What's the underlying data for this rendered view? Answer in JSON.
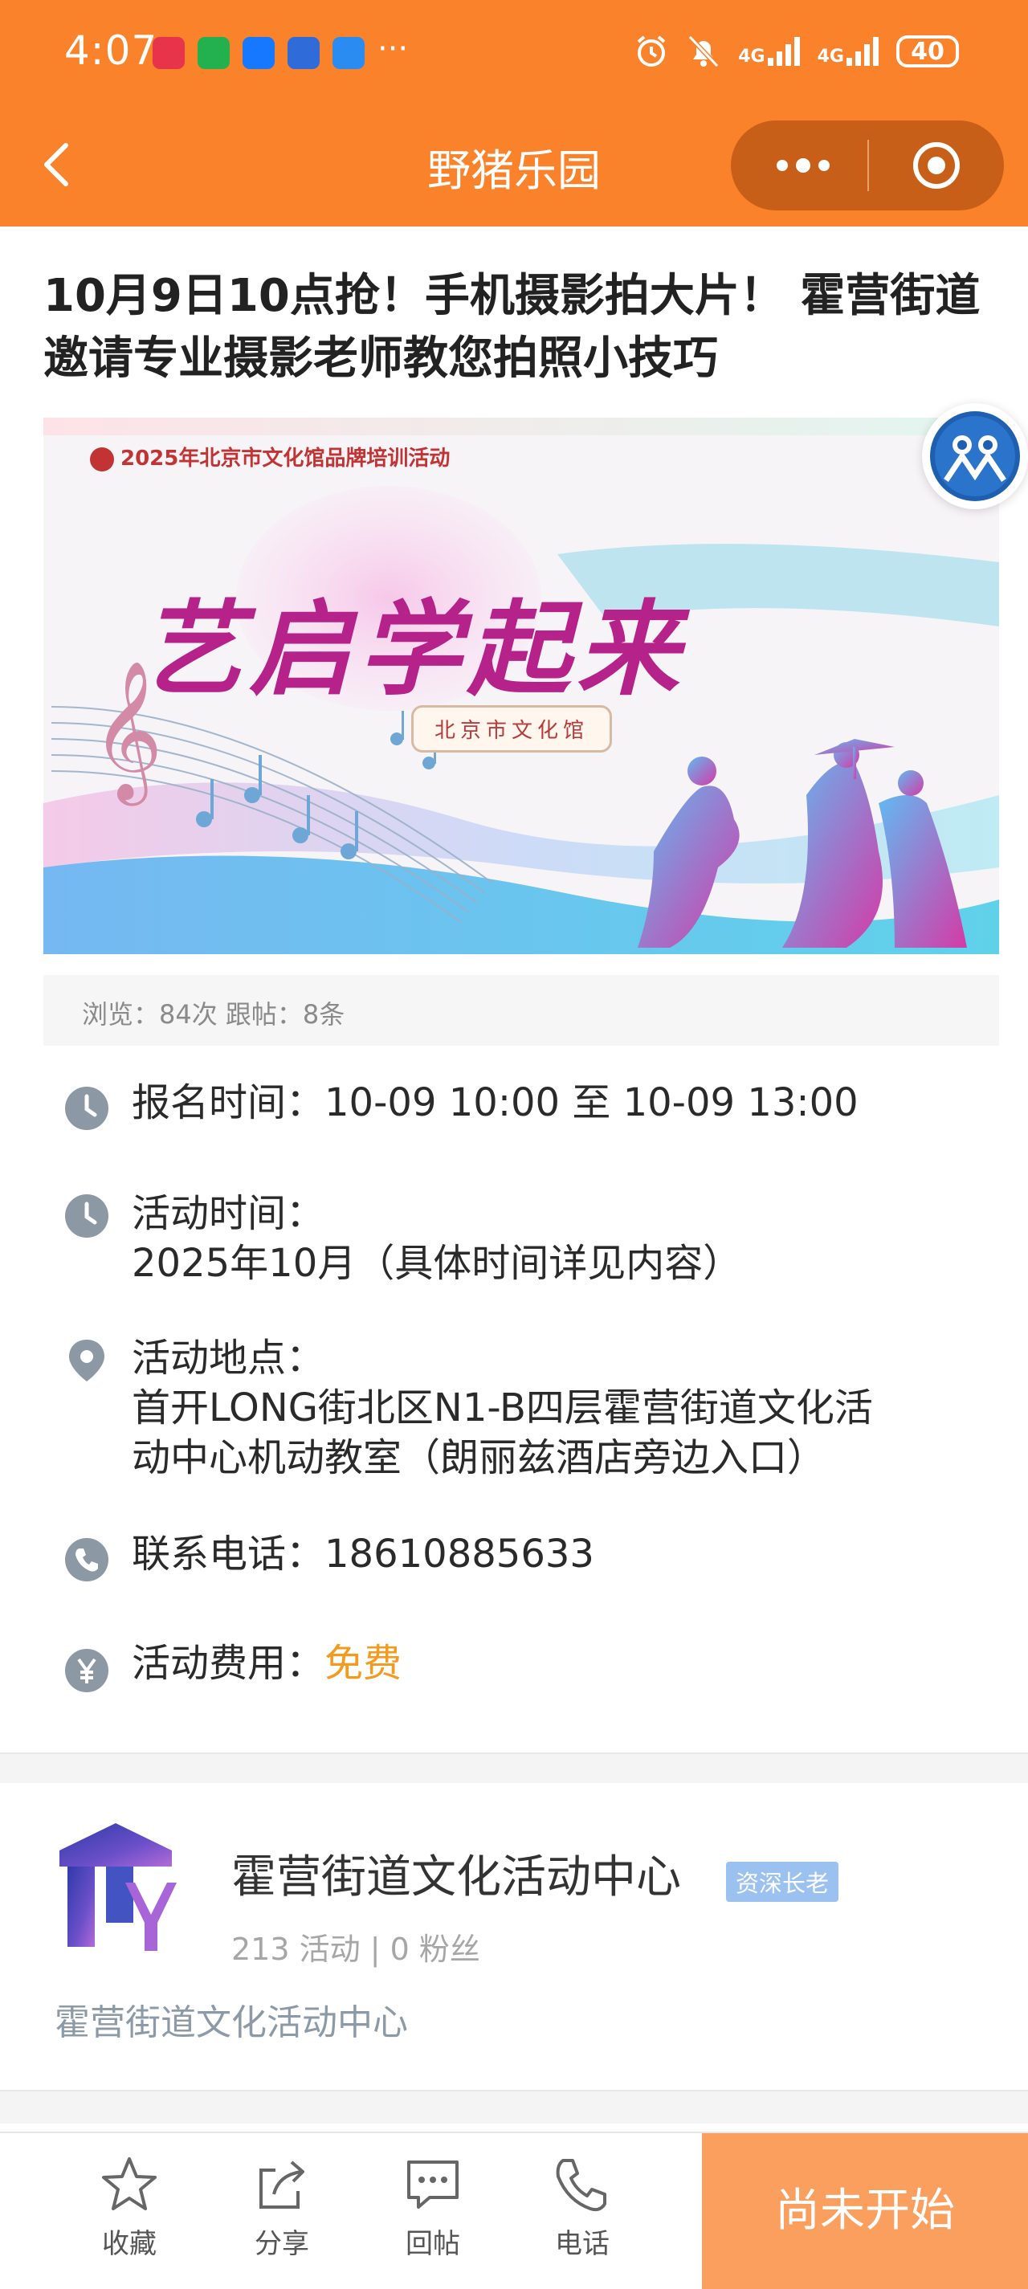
{
  "status_bar": {
    "time": "4:07",
    "signal_1": "4G",
    "signal_2": "4G",
    "battery": "40",
    "more": "···"
  },
  "nav": {
    "title": "野猪乐园",
    "back_label": "<"
  },
  "article": {
    "title": "10月9日10点抢！手机摄影拍大片！ 霍营街道邀请专业摄影老师教您拍照小技巧"
  },
  "banner": {
    "top_text": "2025年北京市文化馆品牌培训活动",
    "main_text": "艺启学起来",
    "sub_text": "北京市文化馆"
  },
  "stats": {
    "text": "浏览：84次 跟帖：8条"
  },
  "info": {
    "signup": {
      "label": "报名时间：",
      "value": "10-09 10:00 至 10-09 13:00"
    },
    "activity_time": {
      "label": "活动时间：",
      "value": "2025年10月（具体时间详见内容）"
    },
    "location": {
      "label": "活动地点：",
      "value_line1": "首开LONG街北区N1-B四层霍营街道文化活",
      "value_line2": "动中心机动教室（朗丽兹酒店旁边入口）"
    },
    "phone": {
      "label": "联系电话：",
      "value": "18610885633"
    },
    "fee": {
      "label": "活动费用：",
      "value": "免费"
    }
  },
  "organizer": {
    "name": "霍营街道文化活动中心",
    "badge": "资深长老",
    "stats": "213 活动 | 0 粉丝",
    "description": "霍营街道文化活动中心"
  },
  "bottom_bar": {
    "favorite": "收藏",
    "share": "分享",
    "reply": "回帖",
    "phone": "电话",
    "cta": "尚未开始"
  },
  "colors": {
    "primary": "#fa822b",
    "cta": "#fb9f5e",
    "fee": "#f39a1f",
    "badge": "#9bc1f0"
  }
}
